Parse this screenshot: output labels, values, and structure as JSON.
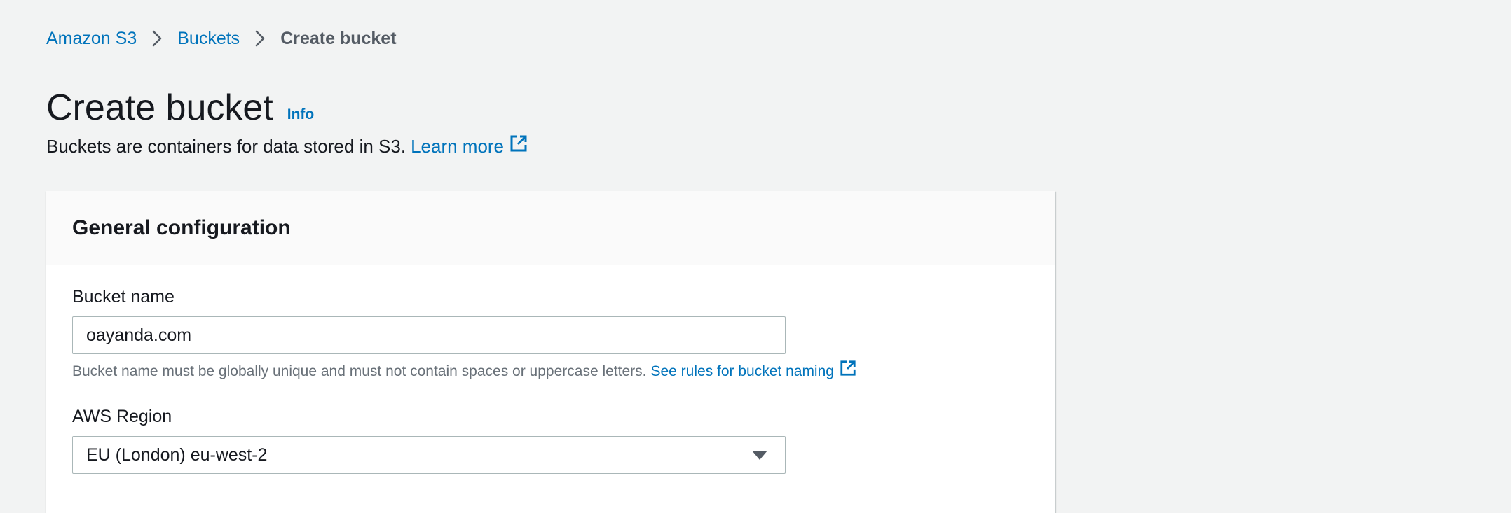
{
  "breadcrumb": {
    "items": [
      {
        "label": "Amazon S3"
      },
      {
        "label": "Buckets"
      },
      {
        "label": "Create bucket"
      }
    ]
  },
  "header": {
    "title": "Create bucket",
    "info_label": "Info",
    "description": "Buckets are containers for data stored in S3.",
    "learn_more_label": "Learn more"
  },
  "general_config": {
    "title": "General configuration",
    "bucket_name": {
      "label": "Bucket name",
      "value": "oayanda.com",
      "constraint": "Bucket name must be globally unique and must not contain spaces or uppercase letters.",
      "rules_link_label": "See rules for bucket naming"
    },
    "region": {
      "label": "AWS Region",
      "selected": "EU (London) eu-west-2"
    }
  },
  "icons": {
    "separator": "chevron-right-icon",
    "external": "external-link-icon",
    "dropdown": "caret-down-icon"
  },
  "colors": {
    "link": "#0073bb",
    "background": "#f2f3f3",
    "text": "#16191f",
    "muted": "#687078"
  }
}
